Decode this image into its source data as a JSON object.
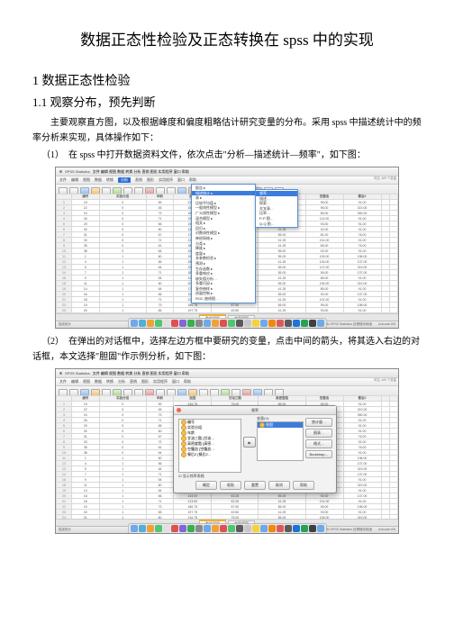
{
  "doc": {
    "title": "数据正态性检验及正态转换在 spss 中的实现",
    "section1": "1 数据正态性检验",
    "section11": "1.1 观察分布，预先判断",
    "para_intro": "主要观察直方图，以及根据峰度和偏度粗略估计研究变量的分布。采用 spss 中描述统计中的频率分析来实现，具体操作如下：",
    "step1": "（1）　在 spss 中打开数据资料文件，依次点击\"分析—描述统计—频率\"，如下图：",
    "step2": "（2）　在弹出的对话框中，选择左边方框中要研究的变量，点击中间的箭头，将其选入右边的对话框，本文选择\"胆固\"作示例分析，如下图："
  },
  "mac": {
    "app": "SPSS Statistics",
    "menus": [
      "文件",
      "编辑",
      "视图",
      "数据",
      "转换",
      "分析",
      "直销",
      "图形",
      "实用程序",
      "窗口",
      "帮助"
    ],
    "analyze": "分析"
  },
  "columns": [
    "编号",
    "实验分组",
    "年龄",
    "胆固",
    "甘油三酯",
    "高密度脂",
    "空腹血",
    "餐后2"
  ],
  "menu1": {
    "items": [
      "报告",
      "描述统计",
      "表",
      "比较平均值",
      "一般线性模型",
      "广义线性模型",
      "混合模型",
      "相关",
      "回归",
      "对数线性模型",
      "神经网络",
      "分类",
      "降维",
      "度量",
      "非参数检验",
      "预测",
      "生存函数",
      "多重响应",
      "缺失值分析…",
      "多重归因",
      "复杂抽样",
      "质量控制",
      "ROC 曲线图…"
    ],
    "sel": "描述统计"
  },
  "menu2": {
    "items": [
      "频率…",
      "描述…",
      "探索…",
      "交叉表…",
      "比率…",
      "P-P 图…",
      "Q-Q 图…"
    ],
    "sel": "频率…"
  },
  "tabs": {
    "data": "数据视图",
    "var": "变量视图"
  },
  "status": {
    "left": "描述统计",
    "right": "IBM SPSS Statistics 处理程序就绪　　Unicode:ON"
  },
  "winlabel": "可见: 8/8 个变量",
  "rows": [
    [
      "1",
      "15",
      "0",
      "59",
      "216.75",
      "75.00",
      "55.00",
      "95.00",
      "91.00"
    ],
    [
      "2",
      "22",
      "0",
      "45",
      "153.25",
      "36.25",
      "58.75",
      "95.00",
      "319.00"
    ],
    [
      "3",
      "24",
      "0",
      "73",
      "154.25",
      "55.00",
      "96.25",
      "85.00",
      "350.00"
    ],
    [
      "4",
      "26",
      "0",
      "71",
      "234.25",
      "143.50",
      "41.25",
      "113.00",
      "91.00"
    ],
    [
      "5",
      "29",
      "0",
      "65",
      "197.75",
      "49.50",
      "55.00",
      "93.00",
      "91.00"
    ],
    [
      "6",
      "30",
      "0",
      "60",
      "134.00",
      "63.25",
      "41.25",
      "92.00",
      "91.00"
    ],
    [
      "7",
      "31",
      "0",
      "67",
      "174.50",
      "36.50",
      "55.00",
      "81.00",
      "76.00"
    ],
    [
      "8",
      "33",
      "0",
      "72",
      "213.50",
      "52.25",
      "41.25",
      "101.00",
      "91.00"
    ],
    [
      "9",
      "35",
      "0",
      "61",
      "186.75",
      "57.50",
      "41.25",
      "85.00",
      "76.00"
    ],
    [
      "10",
      "38",
      "0",
      "64",
      "243.50",
      "87.75",
      "55.00",
      "92.00",
      "91.00"
    ],
    [
      "11",
      "1",
      "1",
      "60",
      "199.00",
      "114.50",
      "55.00",
      "105.00",
      "198.00"
    ],
    [
      "12",
      "4",
      "1",
      "56",
      "243.25",
      "87.75",
      "41.25",
      "103.00",
      "137.00"
    ],
    [
      "13",
      "5",
      "1",
      "64",
      "231.50",
      "75.00",
      "55.00",
      "107.00",
      "319.00"
    ],
    [
      "14",
      "7",
      "1",
      "71",
      "186.75",
      "49.50",
      "55.00",
      "95.00",
      "137.00"
    ],
    [
      "16",
      "9",
      "1",
      "54",
      "216.75",
      "57.50",
      "41.25",
      "85.00",
      "91.00"
    ],
    [
      "18",
      "11",
      "1",
      "60",
      "207.00",
      "143.50",
      "55.00",
      "105.00",
      "319.00"
    ],
    [
      "19",
      "14",
      "1",
      "64",
      "174.50",
      "36.50",
      "41.25",
      "85.00",
      "91.00"
    ],
    [
      "20",
      "16",
      "1",
      "56",
      "134.00",
      "63.25",
      "55.00",
      "92.00",
      "137.00"
    ],
    [
      "21",
      "18",
      "1",
      "71",
      "213.50",
      "52.25",
      "41.25",
      "101.00",
      "91.00"
    ],
    [
      "22",
      "19",
      "1",
      "73",
      "186.75",
      "57.50",
      "55.00",
      "95.00",
      "198.00"
    ],
    [
      "23",
      "20",
      "1",
      "65",
      "197.75",
      "49.50",
      "41.25",
      "93.00",
      "91.00"
    ],
    [
      "24",
      "21",
      "1",
      "60",
      "216.75",
      "75.00",
      "55.00",
      "105.00",
      "319.00"
    ]
  ],
  "dialog": {
    "title": "频率",
    "left_vars": [
      "编号",
      "实验分组",
      "年龄",
      "甘油三酯 [甘油…",
      "高密度脂 [高密…",
      "空腹血 [空腹血…",
      "餐后2 [餐后2…"
    ],
    "sel_var": "胆固",
    "target_label": "变量(V):",
    "checkbox": "显示频率表格",
    "buttons": {
      "stat": "统计量…",
      "chart": "图表…",
      "format": "格式…",
      "boot": "Bootstrap…"
    },
    "footer": {
      "ok": "确定",
      "paste": "粘贴",
      "reset": "重置",
      "cancel": "取消",
      "help": "帮助"
    }
  },
  "dock_colors": [
    "#6fa9e8",
    "#4fb0d8",
    "#f0a334",
    "#4fc76f",
    "#e0e0e0",
    "#e05050",
    "#8466d6",
    "#37b14e",
    "#8b8b8b",
    "#6fa9e8",
    "#f0a334",
    "#e05050",
    "#4fc76f",
    "#5b5b5b",
    "#c8c8c8",
    "#f5d23b",
    "#6fa9e8",
    "#f0890c",
    "#de5a5a",
    "#5b5b5b",
    "#1e73d6",
    "#23a455",
    "#404040",
    "#6fa9e8"
  ]
}
